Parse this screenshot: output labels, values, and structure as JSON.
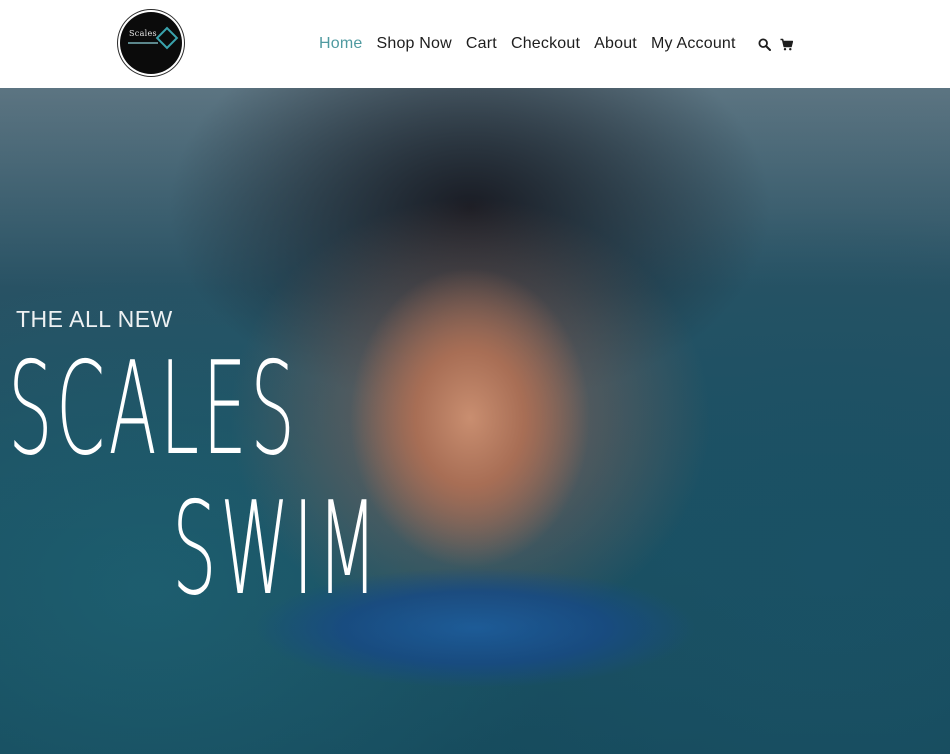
{
  "logo": {
    "text": "Scales"
  },
  "nav": {
    "items": [
      {
        "label": "Home",
        "active": true
      },
      {
        "label": "Shop Now",
        "active": false
      },
      {
        "label": "Cart",
        "active": false
      },
      {
        "label": "Checkout",
        "active": false
      },
      {
        "label": "About",
        "active": false
      },
      {
        "label": "My Account",
        "active": false
      }
    ],
    "icons": [
      "search-icon",
      "cart-icon"
    ],
    "active_color": "#4f9aa0"
  },
  "hero": {
    "eyebrow": "THE ALL NEW",
    "title_line1": "SCALES",
    "title_line2": "SWIM"
  }
}
